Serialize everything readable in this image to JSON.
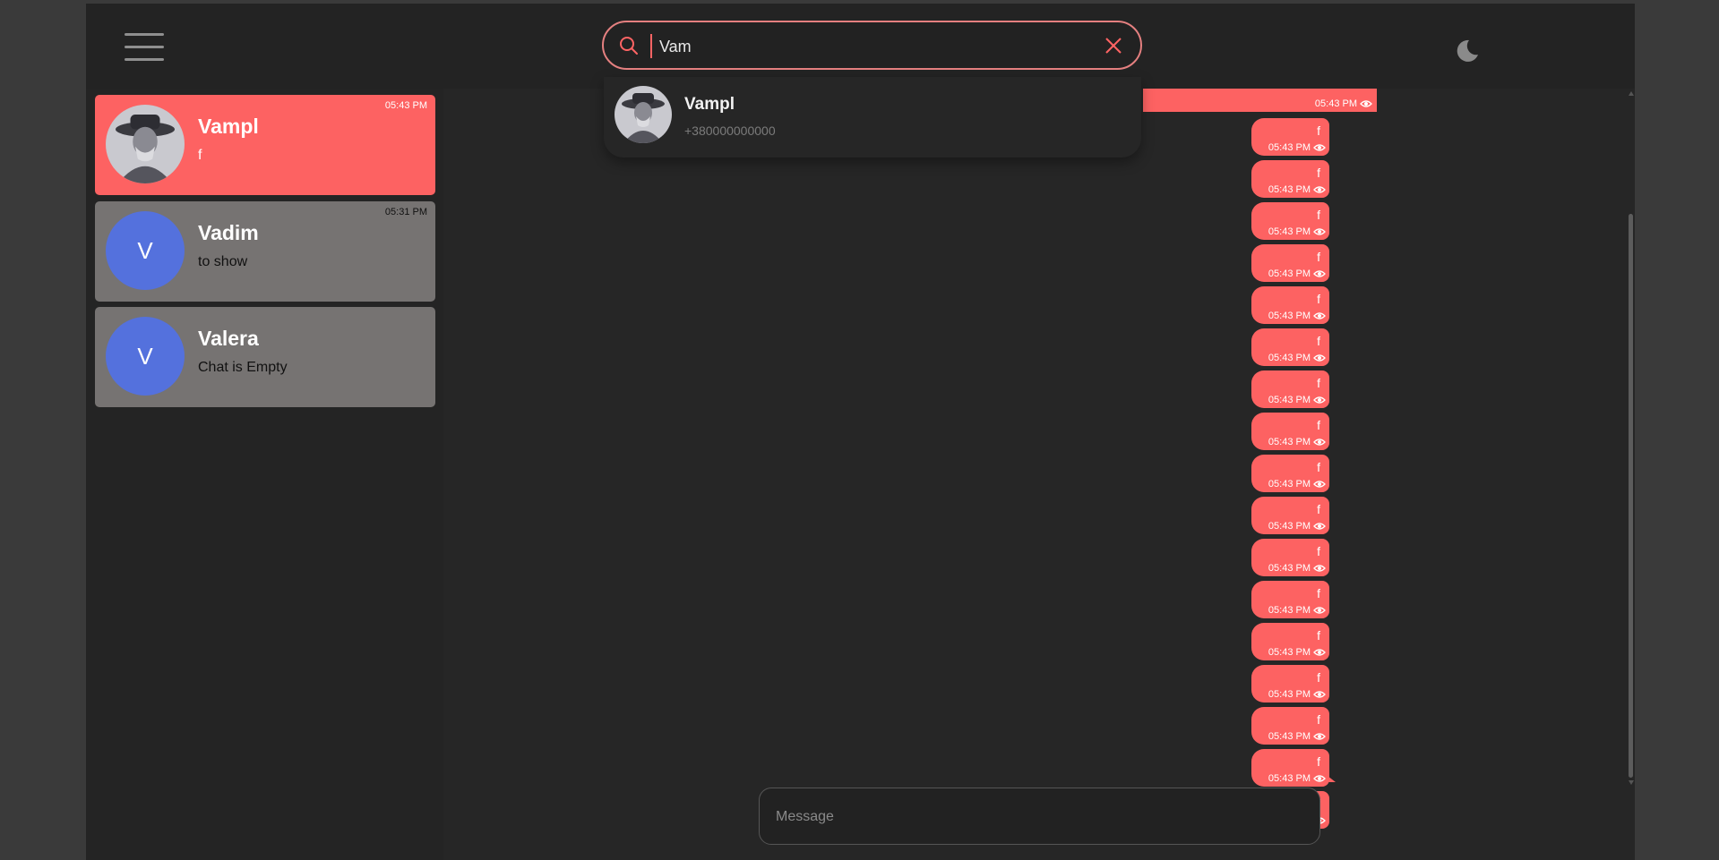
{
  "search": {
    "value": "Vam",
    "results": [
      {
        "name": "Vampl",
        "phone": "+380000000000"
      }
    ]
  },
  "chats": [
    {
      "name": "Vampl",
      "last_message": "f",
      "time": "05:43 PM",
      "avatar": "photo"
    },
    {
      "name": "Vadim",
      "last_message": "to show",
      "time": "05:31 PM",
      "avatar_letter": "V"
    },
    {
      "name": "Valera",
      "last_message": "Chat is Empty",
      "time": "",
      "avatar_letter": "V"
    }
  ],
  "messages": [
    {
      "text": "f",
      "time": "05:43 PM"
    },
    {
      "text": "f",
      "time": "05:43 PM"
    },
    {
      "text": "f",
      "time": "05:43 PM"
    },
    {
      "text": "f",
      "time": "05:43 PM"
    },
    {
      "text": "f",
      "time": "05:43 PM"
    },
    {
      "text": "f",
      "time": "05:43 PM"
    },
    {
      "text": "f",
      "time": "05:43 PM"
    },
    {
      "text": "f",
      "time": "05:43 PM"
    },
    {
      "text": "f",
      "time": "05:43 PM"
    },
    {
      "text": "f",
      "time": "05:43 PM"
    },
    {
      "text": "f",
      "time": "05:43 PM"
    },
    {
      "text": "f",
      "time": "05:43 PM"
    },
    {
      "text": "f",
      "time": "05:43 PM"
    },
    {
      "text": "f",
      "time": "05:43 PM"
    },
    {
      "text": "f",
      "time": "05:43 PM"
    },
    {
      "text": "f",
      "time": "05:43 PM"
    },
    {
      "text": "f",
      "time": "05:43 PM"
    }
  ],
  "partial_message": {
    "time": "05:43 PM"
  },
  "composer": {
    "placeholder": "Message"
  },
  "colors": {
    "accent": "#fd6262",
    "avatar_blue": "#5471dd",
    "inactive_chat": "#767372",
    "background": "#262626"
  },
  "icons": {
    "menu": "hamburger-icon",
    "search": "search-icon",
    "clear": "close-icon",
    "theme": "moon-icon",
    "read": "eye-icon"
  }
}
